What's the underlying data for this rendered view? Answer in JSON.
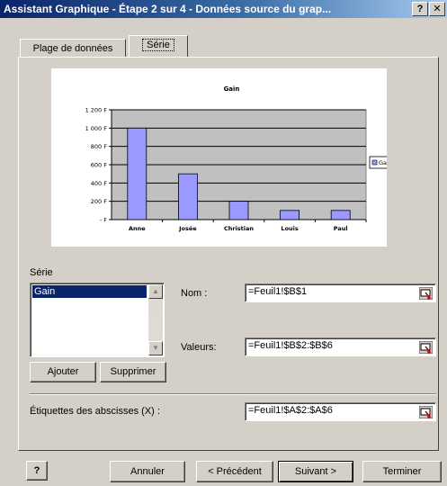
{
  "window": {
    "title": "Assistant Graphique - Étape 2 sur 4 - Données source du grap...",
    "help_label": "?",
    "close_label": "✕"
  },
  "tabs": [
    {
      "label": "Plage de données"
    },
    {
      "label": "Série"
    }
  ],
  "chart_data": {
    "type": "bar",
    "title": "Gain",
    "categories": [
      "Anne",
      "Josée",
      "Christian",
      "Louis",
      "Paul"
    ],
    "series": [
      {
        "name": "Gain",
        "values": [
          1000,
          500,
          200,
          100,
          100
        ],
        "color": "#9999ff"
      }
    ],
    "ylim": [
      0,
      1200
    ],
    "yticks": [
      "-   F",
      "200 F",
      "400 F",
      "600 F",
      "800 F",
      "1 000 F",
      "1 200 F"
    ],
    "plot_background": "#c0c0c0",
    "grid": true,
    "legend": "right"
  },
  "serie": {
    "group_label": "Série",
    "items": [
      "Gain"
    ],
    "nom_label": "Nom :",
    "nom_value": "=Feuil1!$B$1",
    "valeurs_label": "Valeurs:",
    "valeurs_value": "=Feuil1!$B$2:$B$6",
    "ajouter_label": "Ajouter",
    "supprimer_label": "Supprimer",
    "etiquettes_label": "Étiquettes des abscisses (X) :",
    "etiquettes_value": "=Feuil1!$A$2:$A$6"
  },
  "footer": {
    "help_icon_label": "?",
    "annuler": "Annuler",
    "precedent": "< Précédent",
    "suivant": "Suivant >",
    "terminer": "Terminer"
  },
  "colors": {
    "title_gradient_start": "#0a246a",
    "dialog_face": "#d4d0c8",
    "selection": "#0a246a",
    "bar_fill": "#9999ff"
  }
}
